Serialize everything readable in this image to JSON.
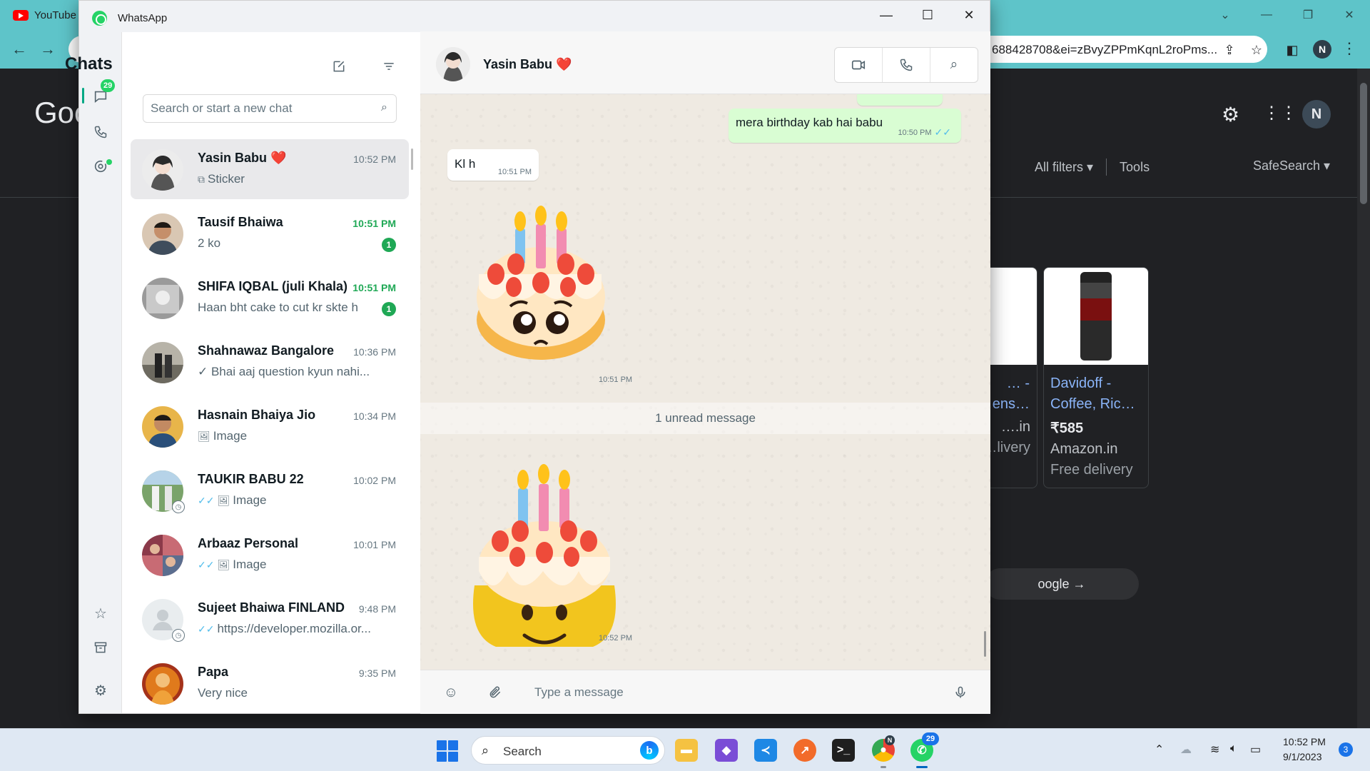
{
  "chrome": {
    "tab_title": "YouTube",
    "url": "688428708&ei=zBvyZPPmKqnL2roPms...",
    "avatar_letter": "N"
  },
  "google": {
    "logo": "Goo",
    "avatar_letter": "N",
    "filters": {
      "all_filters": "All filters ▾",
      "tools": "Tools",
      "safesearch": "SafeSearch ▾"
    },
    "cards": [
      {
        "title": "… -\n…ens…",
        "price": "",
        "store": "….in",
        "delivery": "…livery"
      },
      {
        "title": "Davidoff -\nCoffee, Ric…",
        "price": "₹585",
        "store": "Amazon.in",
        "delivery": "Free delivery"
      }
    ],
    "more_button": "oogle →"
  },
  "whatsapp": {
    "window_title": "WhatsApp",
    "rail_badge": "29",
    "chats_title": "Chats",
    "search_placeholder": "Search or start a new chat",
    "chats": [
      {
        "name": "Yasin Babu ❤️",
        "time": "10:52 PM",
        "preview": "Sticker",
        "preview_icon": "sticker",
        "selected": true
      },
      {
        "name": "Tausif Bhaiwa",
        "time": "10:51 PM",
        "preview": "2 ko",
        "unread": "1"
      },
      {
        "name": "SHIFA IQBAL (juli Khala)",
        "time": "10:51 PM",
        "preview": "Haan bht cake to cut kr skte h",
        "unread": "1"
      },
      {
        "name": "Shahnawaz Bangalore",
        "time": "10:36 PM",
        "preview": "✓ Bhai aaj question kyun nahi..."
      },
      {
        "name": "Hasnain Bhaiya Jio",
        "time": "10:34 PM",
        "preview": "Image",
        "preview_icon": "image"
      },
      {
        "name": "TAUKIR BABU 22",
        "time": "10:02 PM",
        "preview": "Image",
        "preview_icon": "image",
        "double_tick": true
      },
      {
        "name": "Arbaaz Personal",
        "time": "10:01 PM",
        "preview": "Image",
        "preview_icon": "image",
        "double_tick": true
      },
      {
        "name": "Sujeet Bhaiwa FINLAND",
        "time": "9:48 PM",
        "preview": "https://developer.mozilla.or...",
        "double_tick": true
      },
      {
        "name": "Papa",
        "time": "9:35 PM",
        "preview": "Very nice"
      }
    ],
    "conversation": {
      "contact_name": "Yasin Babu ❤️",
      "messages": [
        {
          "direction": "out",
          "text": "mera birthday kab hai babu",
          "time": "10:50 PM"
        },
        {
          "direction": "in",
          "text": "Kl h",
          "time": "10:51 PM"
        },
        {
          "direction": "in",
          "sticker": "cake-pleading",
          "time": "10:51 PM"
        },
        {
          "direction": "in",
          "sticker": "cake-smile",
          "time": "10:52 PM"
        }
      ],
      "unread_divider": "1 unread message",
      "input_placeholder": "Type a message"
    }
  },
  "taskbar": {
    "search_label": "Search",
    "whatsapp_badge": "29",
    "chrome_badge": "N",
    "time": "10:52 PM",
    "date": "9/1/2023",
    "notifications": "3"
  }
}
